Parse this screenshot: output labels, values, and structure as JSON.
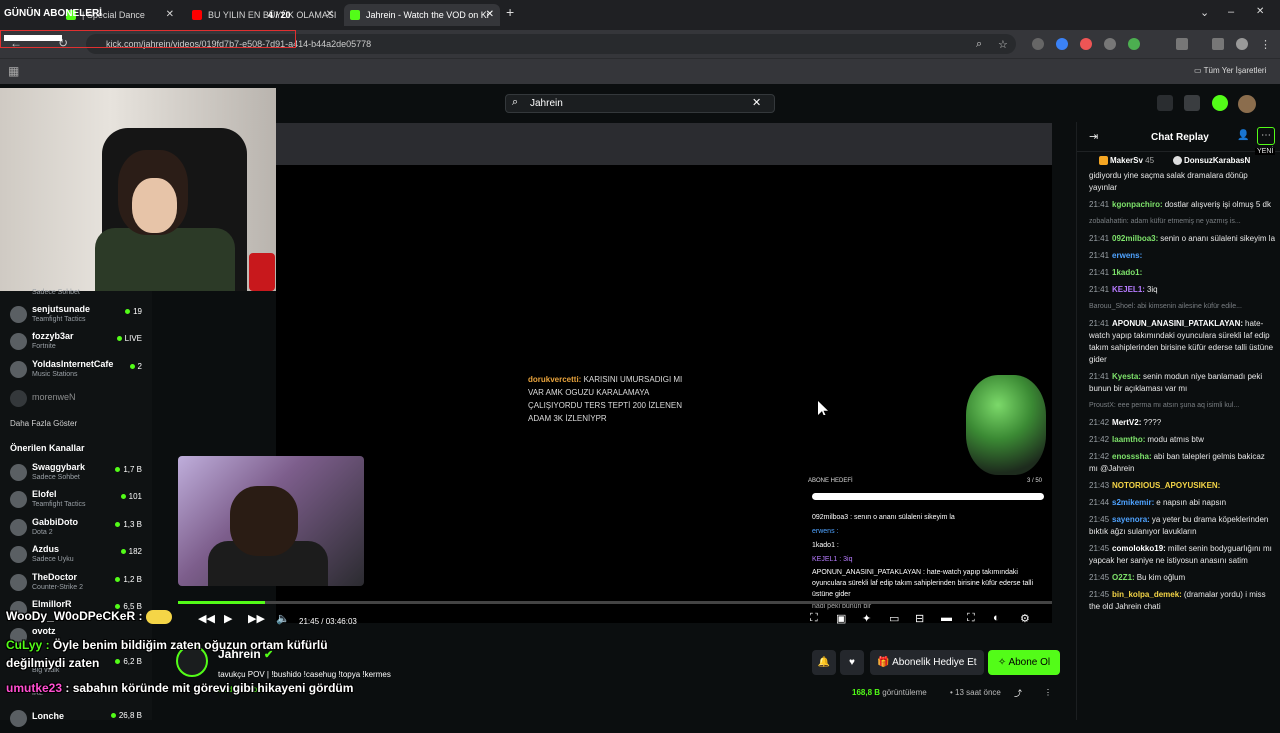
{
  "browser": {
    "tabs": [
      {
        "label": "| Special Dance",
        "icon": "kick-icon",
        "active": false
      },
      {
        "label": "BU YILIN EN BÜYÜK OLAMASI",
        "icon": "youtube-icon",
        "active": false
      },
      {
        "label": "Jahrein - Watch the VOD on Ki",
        "icon": "kick-icon",
        "active": true
      }
    ],
    "new_tab": "+",
    "url": "kick.com/jahrein/videos/019fd7b7-e508-7d91-a414-b44a2de05778",
    "bookmarks_label": "Tüm Yer İşaretleri",
    "window_controls": [
      "–",
      "❐",
      "✕"
    ],
    "collapse": "⌄"
  },
  "overlay": {
    "gunun_aboneleri": "GÜNÜN ABONELERİ",
    "counter": "4 / 20",
    "chat": [
      {
        "name": "WooDy_W0oDPeCKeR :",
        "text": ""
      },
      {
        "name": "CuLyy :",
        "text": "Öyle benim bildiğim zaten oğuzun ortam küfürlü değilmiydi zaten"
      },
      {
        "name": "umutke23",
        "text": ": sabahın köründe mit görevi gibi hikayeni gördüm"
      }
    ]
  },
  "search": {
    "value": "Jahrein",
    "clear": "✕"
  },
  "sidebar": {
    "top_partial": "Sadece Sohbet",
    "channels": [
      {
        "name": "senjutsunade",
        "game": "Teamfight Tactics",
        "viewers": "19"
      },
      {
        "name": "fozzyb3ar",
        "game": "Fortnite",
        "viewers": "LIVE"
      },
      {
        "name": "YoldasInternetCafe",
        "game": "Music Stations",
        "viewers": "2"
      },
      {
        "name": "morenweN",
        "game": "",
        "viewers": ""
      }
    ],
    "show_more": "Daha Fazla Göster",
    "recommended_title": "Önerilen Kanallar",
    "recommended": [
      {
        "name": "Swaggybark",
        "game": "Sadece Sohbet",
        "viewers": "1,7 B"
      },
      {
        "name": "Elofel",
        "game": "Teamfight Tactics",
        "viewers": "101"
      },
      {
        "name": "GabbiDoto",
        "game": "Dota 2",
        "viewers": "1,3 B"
      },
      {
        "name": "Azdus",
        "game": "Sadece Uyku",
        "viewers": "182"
      },
      {
        "name": "TheDoctor",
        "game": "Counter-Strike 2",
        "viewers": "1,2 B"
      },
      {
        "name": "ElmillorR",
        "game": "",
        "viewers": "6,5 B"
      },
      {
        "name": "ovotz",
        "game": "",
        "viewers": ""
      },
      {
        "name": "",
        "game": "Big Walk",
        "viewers": "6,2 B"
      },
      {
        "name": "",
        "game": "IRL",
        "viewers": ""
      },
      {
        "name": "Lonche",
        "game": "",
        "viewers": "26,8 B"
      }
    ]
  },
  "video": {
    "stream_chat_text": "dorukvercetti: KARISINI UMURSADIGI MI VAR AMK OGUZU KARALAMAYA ÇALIŞIYORDU TERS TEPTİ 200 İZLENEN ADAM 3K İZLENİYPR",
    "stream_chat_user": "dorukvercetti:",
    "stream_chat_body": "KARISINI UMURSADIGI MI VAR AMK OGUZU KARALAMAYA ÇALIŞIYORDU TERS TEPTİ 200 İZLENEN ADAM 3K İZLENİYPR",
    "goal_label": "ABONE HEDEFİ",
    "goal_count": "3 / 50",
    "inner_chat": [
      "092milboa3 : senın o ananı sülaleni sikeyim la",
      "erwens :",
      "1kado1 :",
      "KEJEL1 : 3iq",
      "APONUN_ANASINI_PATAKLAYAN : hate-watch yapıp takımındaki oyunculara sürekli laf edip takım sahiplerinden birisine küfür ederse talli üstüne gider",
      "nadi peki bunun bir"
    ],
    "progress": 0.1,
    "time_current": "21:45",
    "time_sep": "/",
    "time_total": "03:46:03"
  },
  "channel": {
    "name": "Jahrein",
    "title": "tavukçu POV | !bushido !casehug !topya !kermes",
    "category": "Sadece Sohbet",
    "gift_label": "Abonelik Hediye Et",
    "sub_label": "Abone Ol",
    "views_num": "168,8 B",
    "views_label": "görüntüleme",
    "time_ago": "13 saat önce"
  },
  "chat": {
    "title": "Chat Replay",
    "new_label": "YENİ",
    "pins": [
      {
        "user": "MakerSv",
        "count": "45"
      },
      {
        "user": "DonsuzKarabasN",
        "count": ""
      }
    ],
    "messages": [
      {
        "time": "",
        "user": "",
        "color": "#fff",
        "text": "gidiyordu yine saçma salak dramalara dönüp yayınlar",
        "deleted": false
      },
      {
        "time": "21:41",
        "user": "kgonpachiro:",
        "color": "#7ee36b",
        "text": "dostlar alışveriş işi olmuş 5 dk",
        "deleted": false
      },
      {
        "time": "",
        "user": "",
        "color": "#888",
        "text": "zobalahattin: adam küfür etmemiş ne yazmış is...",
        "deleted": true
      },
      {
        "time": "21:41",
        "user": "092milboa3:",
        "color": "#7ee36b",
        "text": "senin o ananı sülaleni sikeyim la",
        "deleted": false
      },
      {
        "time": "21:41",
        "user": "erwens:",
        "color": "#4fa3ff",
        "text": "",
        "deleted": false
      },
      {
        "time": "21:41",
        "user": "1kado1:",
        "color": "#7ee36b",
        "text": "",
        "deleted": false
      },
      {
        "time": "21:41",
        "user": "KEJEL1:",
        "color": "#b77bff",
        "text": "3iq",
        "deleted": false
      },
      {
        "time": "",
        "user": "",
        "color": "#888",
        "text": "Barouu_Shoel: abi kimsenin ailesine küfür edile...",
        "deleted": true
      },
      {
        "time": "21:41",
        "user": "APONUN_ANASINI_PATAKLAYAN:",
        "color": "#fff",
        "text": "hate-watch yapıp takımındaki oyunculara sürekli laf edip takım sahiplerinden birisine küfür ederse talli üstüne gider",
        "deleted": false
      },
      {
        "time": "21:41",
        "user": "Kyesta:",
        "color": "#7ee36b",
        "text": "senin modun niye banlamadı peki bunun bir açıklaması var mı",
        "deleted": false
      },
      {
        "time": "",
        "user": "",
        "color": "#888",
        "text": "ProustX: eee perma mı atsın şuna aq isimli kul...",
        "deleted": true
      },
      {
        "time": "21:42",
        "user": "MertV2:",
        "color": "#fff",
        "text": "????",
        "deleted": false
      },
      {
        "time": "21:42",
        "user": "laamtho:",
        "color": "#7ee36b",
        "text": "modu atmıs btw",
        "deleted": false
      },
      {
        "time": "21:42",
        "user": "enosssha:",
        "color": "#7ee36b",
        "text": "abi ban talepleri gelmis bakicaz mı @Jahrein",
        "deleted": false
      },
      {
        "time": "21:43",
        "user": "NOTORIOUS_APOYUSIKEN:",
        "color": "#f5d547",
        "text": "",
        "deleted": false
      },
      {
        "time": "21:44",
        "user": "s2mikemir:",
        "color": "#4fa3ff",
        "text": "e napsın abi napsın",
        "deleted": false
      },
      {
        "time": "21:45",
        "user": "sayenora:",
        "color": "#4fa3ff",
        "text": "ya yeter bu drama köpeklerinden bıktık ağzı sulanıyor lavukların",
        "deleted": false
      },
      {
        "time": "21:45",
        "user": "comolokko19:",
        "color": "#fff",
        "text": "millet senin bodyguarlığını mı yapcak her saniye ne istiyosun anasını satim",
        "deleted": false
      },
      {
        "time": "21:45",
        "user": "O2Z1:",
        "color": "#7ee36b",
        "text": "Bu kim oğlum",
        "deleted": false
      },
      {
        "time": "21:45",
        "user": "bin_kolpa_demek:",
        "color": "#f5d547",
        "text": "(dramalar yordu) i miss the old Jahrein chati",
        "deleted": false
      }
    ]
  }
}
